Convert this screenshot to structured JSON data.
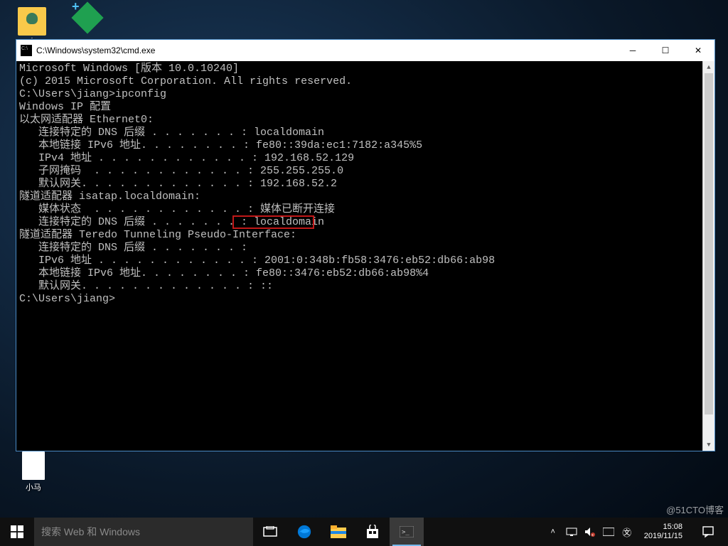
{
  "desktop": {
    "icons": {
      "user_label": "j",
      "file_label": "小马"
    }
  },
  "cmd": {
    "title": "C:\\Windows\\system32\\cmd.exe",
    "lines": [
      "Microsoft Windows [版本 10.0.10240]",
      "(c) 2015 Microsoft Corporation. All rights reserved.",
      "",
      "C:\\Users\\jiang>ipconfig",
      "",
      "Windows IP 配置",
      "",
      "",
      "以太网适配器 Ethernet0:",
      "",
      "   连接特定的 DNS 后缀 . . . . . . . : localdomain",
      "   本地链接 IPv6 地址. . . . . . . . : fe80::39da:ec1:7182:a345%5",
      "   IPv4 地址 . . . . . . . . . . . . : 192.168.52.129",
      "   子网掩码  . . . . . . . . . . . . : 255.255.255.0",
      "   默认网关. . . . . . . . . . . . . : 192.168.52.2",
      "",
      "隧道适配器 isatap.localdomain:",
      "",
      "   媒体状态  . . . . . . . . . . . . : 媒体已断开连接",
      "   连接特定的 DNS 后缀 . . . . . . . : localdomain",
      "",
      "隧道适配器 Teredo Tunneling Pseudo-Interface:",
      "",
      "   连接特定的 DNS 后缀 . . . . . . . :",
      "   IPv6 地址 . . . . . . . . . . . . : 2001:0:348b:fb58:3476:eb52:db66:ab98",
      "   本地链接 IPv6 地址. . . . . . . . : fe80::3476:eb52:db66:ab98%4",
      "   默认网关. . . . . . . . . . . . . : ::",
      "",
      "C:\\Users\\jiang>"
    ],
    "highlighted_value": "192.168.52.129"
  },
  "taskbar": {
    "search_placeholder": "搜索 Web 和 Windows",
    "clock_time": "15:08",
    "clock_date": "2019/11/15"
  },
  "watermark": "@51CTO博客"
}
